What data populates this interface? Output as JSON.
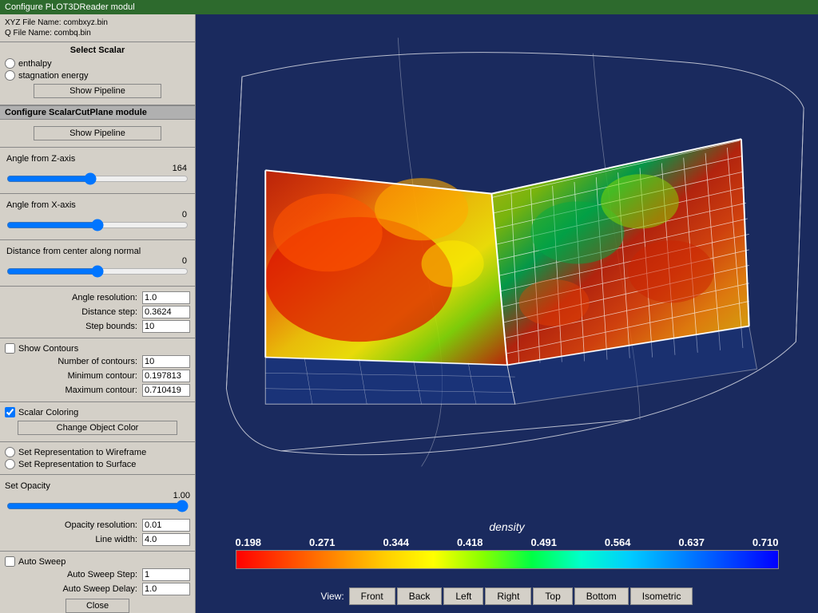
{
  "titleBar": {
    "label": "Configure PLOT3DReader modul"
  },
  "leftPanel": {
    "fileInfo": {
      "xyz": "XYZ File Name: combxyz.bin",
      "q": "Q File Name: combq.bin"
    },
    "selectScalar": {
      "label": "Select Scalar",
      "options": [
        "enthalpy",
        "stagnation energy"
      ]
    },
    "showPipelineBtn": "Show Pipeline",
    "configureHeader": "Configure ScalarCutPlane module",
    "angleFromZ": {
      "label": "Angle from Z-axis",
      "value": "164"
    },
    "angleFromX": {
      "label": "Angle from X-axis",
      "value": "0"
    },
    "distanceFromCenter": {
      "label": "Distance from center along normal",
      "value": "0"
    },
    "angleResolution": {
      "label": "Angle resolution:",
      "value": "1.0"
    },
    "distanceStep": {
      "label": "Distance step:",
      "value": "0.3624"
    },
    "stepBounds": {
      "label": "Step bounds:",
      "value": "10"
    },
    "showContours": {
      "label": "Show Contours"
    },
    "numContours": {
      "label": "Number of contours:",
      "value": "10"
    },
    "minContour": {
      "label": "Minimum contour:",
      "value": "0.197813"
    },
    "maxContour": {
      "label": "Maximum contour:",
      "value": "0.710419"
    },
    "scalarColoring": {
      "label": "Scalar Coloring"
    },
    "changeObjectColor": {
      "label": "Change Object Color"
    },
    "wireframe": {
      "label": "Set Representation to Wireframe"
    },
    "surface": {
      "label": "Set Representation to Surface"
    },
    "setOpacity": {
      "label": "Set Opacity",
      "value": "1.00"
    },
    "opacityResolution": {
      "label": "Opacity resolution:",
      "value": "0.01"
    },
    "lineWidth": {
      "label": "Line width:",
      "value": "4.0"
    },
    "autoSweep": {
      "label": "Auto Sweep"
    },
    "autoSweepStep": {
      "label": "Auto Sweep Step:",
      "value": "1"
    },
    "autoSweepDelay": {
      "label": "Auto Sweep Delay:",
      "value": "1.0"
    },
    "closeBtn": "Close"
  },
  "visualization": {
    "colorbarLabel": "density",
    "colorbarValues": [
      "0.198",
      "0.271",
      "0.344",
      "0.418",
      "0.491",
      "0.564",
      "0.637",
      "0.710"
    ],
    "viewButtons": [
      "Front",
      "Back",
      "Left",
      "Right",
      "Top",
      "Bottom",
      "Isometric"
    ],
    "viewLabel": "View:"
  }
}
